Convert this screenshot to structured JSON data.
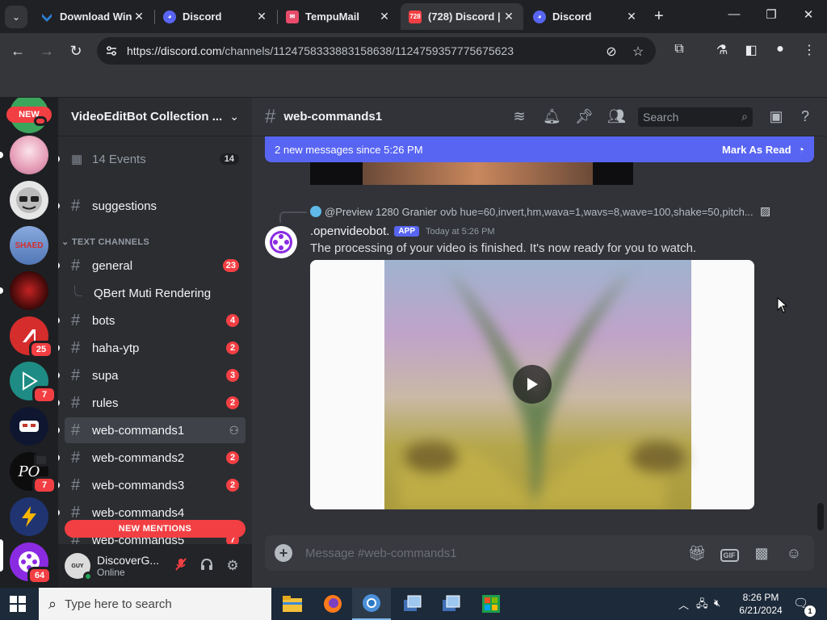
{
  "browser": {
    "tabs": [
      {
        "label": "Download Win",
        "favicon": "vs-icon",
        "color": "#2d7dd2"
      },
      {
        "label": "Discord",
        "favicon": "discord-icon",
        "color": "#5865f2"
      },
      {
        "label": "TempuMail",
        "favicon": "tempumail-icon",
        "color": "#e84c6a"
      },
      {
        "label": "(728) Discord |",
        "favicon": "discord-icon",
        "color": "#5865f2",
        "badge": "728",
        "active": true
      },
      {
        "label": "Discord",
        "favicon": "discord-icon",
        "color": "#5865f2"
      }
    ],
    "url_host": "https://discord.com",
    "url_path": "/channels/1124758333883158638/1124759357775675623",
    "window_controls": [
      "minimize",
      "restore",
      "close"
    ]
  },
  "servers": [
    {
      "name": "new-server",
      "new_label": "NEW",
      "color": "#3ba55c"
    },
    {
      "name": "anime-server",
      "color": "#f1b3c8"
    },
    {
      "name": "glasses-server",
      "color": "#d0d0d0"
    },
    {
      "name": "shaed-server",
      "color": "#6c8ecb",
      "label": "SHAED"
    },
    {
      "name": "red-server",
      "color": "#7a1010"
    },
    {
      "name": "slash-server",
      "color": "#d52c2c",
      "badge": "25"
    },
    {
      "name": "play-server",
      "color": "#1e8c84",
      "badge": "7"
    },
    {
      "name": "face-server",
      "color": "#0f1730"
    },
    {
      "name": "po-server",
      "color": "#101010",
      "label": "PO",
      "badge": "7"
    },
    {
      "name": "bolt-server",
      "color": "#1f3470"
    },
    {
      "name": "video-bot-server",
      "color": "#8a2be2",
      "badge": "64",
      "active": true
    }
  ],
  "guild": {
    "name": "VideoEditBot Collection ...",
    "events_label": "14 Events",
    "events_count": "14",
    "category_label": "TEXT CHANNELS",
    "channels": [
      {
        "name": "suggestions"
      },
      {
        "name": "general",
        "badge": "23"
      },
      {
        "name": "QBert Muti Rendering",
        "thread": true
      },
      {
        "name": "bots",
        "badge": "4"
      },
      {
        "name": "haha-ytp",
        "badge": "2"
      },
      {
        "name": "supa",
        "badge": "3"
      },
      {
        "name": "rules",
        "badge": "2"
      },
      {
        "name": "web-commands1",
        "selected": true
      },
      {
        "name": "web-commands2",
        "badge": "2"
      },
      {
        "name": "web-commands3",
        "badge": "2"
      },
      {
        "name": "web-commands4"
      },
      {
        "name": "web-commands5",
        "badge": "7"
      }
    ],
    "new_mentions": "NEW MENTIONS"
  },
  "user": {
    "name": "DiscoverG...",
    "status": "Online",
    "avatar_text": "GUY"
  },
  "chat": {
    "channel_name": "web-commands1",
    "search_placeholder": "Search",
    "new_messages": "2 new messages since 5:26 PM",
    "mark_as_read": "Mark As Read",
    "reply": {
      "name": "@Preview 1280 Granier",
      "text": "ovb hue=60,invert,hm,wava=1,wavs=8,wave=100,shake=50,pitch..."
    },
    "message": {
      "author": ".openvideobot.",
      "tag": "APP",
      "time": "Today at 5:26 PM",
      "text": "The processing of your video is finished. It's now ready for you to watch."
    },
    "composer_placeholder": "Message #web-commands1",
    "gif_label": "GIF"
  },
  "taskbar": {
    "search_placeholder": "Type here to search",
    "time": "8:26 PM",
    "date": "6/21/2024",
    "notification_count": "1"
  }
}
